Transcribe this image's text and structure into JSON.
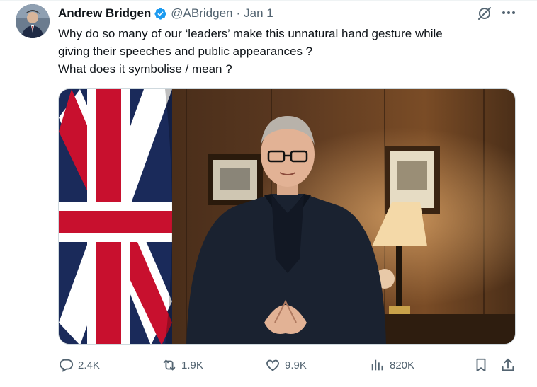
{
  "tweet": {
    "author_name": "Andrew Bridgen",
    "handle": "@ABridgen",
    "separator": "·",
    "date": "Jan 1",
    "text": "Why do so many of our ‘leaders’ make this unnatural hand gesture while\ngiving their speeches and public appearances ?\nWhat does it symbolise / mean ?"
  },
  "icons": {
    "verified": "verified-badge-icon",
    "grok": "grok-icon",
    "more": "more-icon",
    "reply": "reply-icon",
    "retweet": "retweet-icon",
    "like": "like-icon",
    "views": "views-icon",
    "bookmark": "bookmark-icon",
    "share": "share-icon"
  },
  "actions": {
    "replies": "2.4K",
    "retweets": "1.9K",
    "likes": "9.9K",
    "views": "820K"
  },
  "colors": {
    "verified": "#1d9bf0",
    "text_primary": "#0f1419",
    "text_secondary": "#536471"
  }
}
